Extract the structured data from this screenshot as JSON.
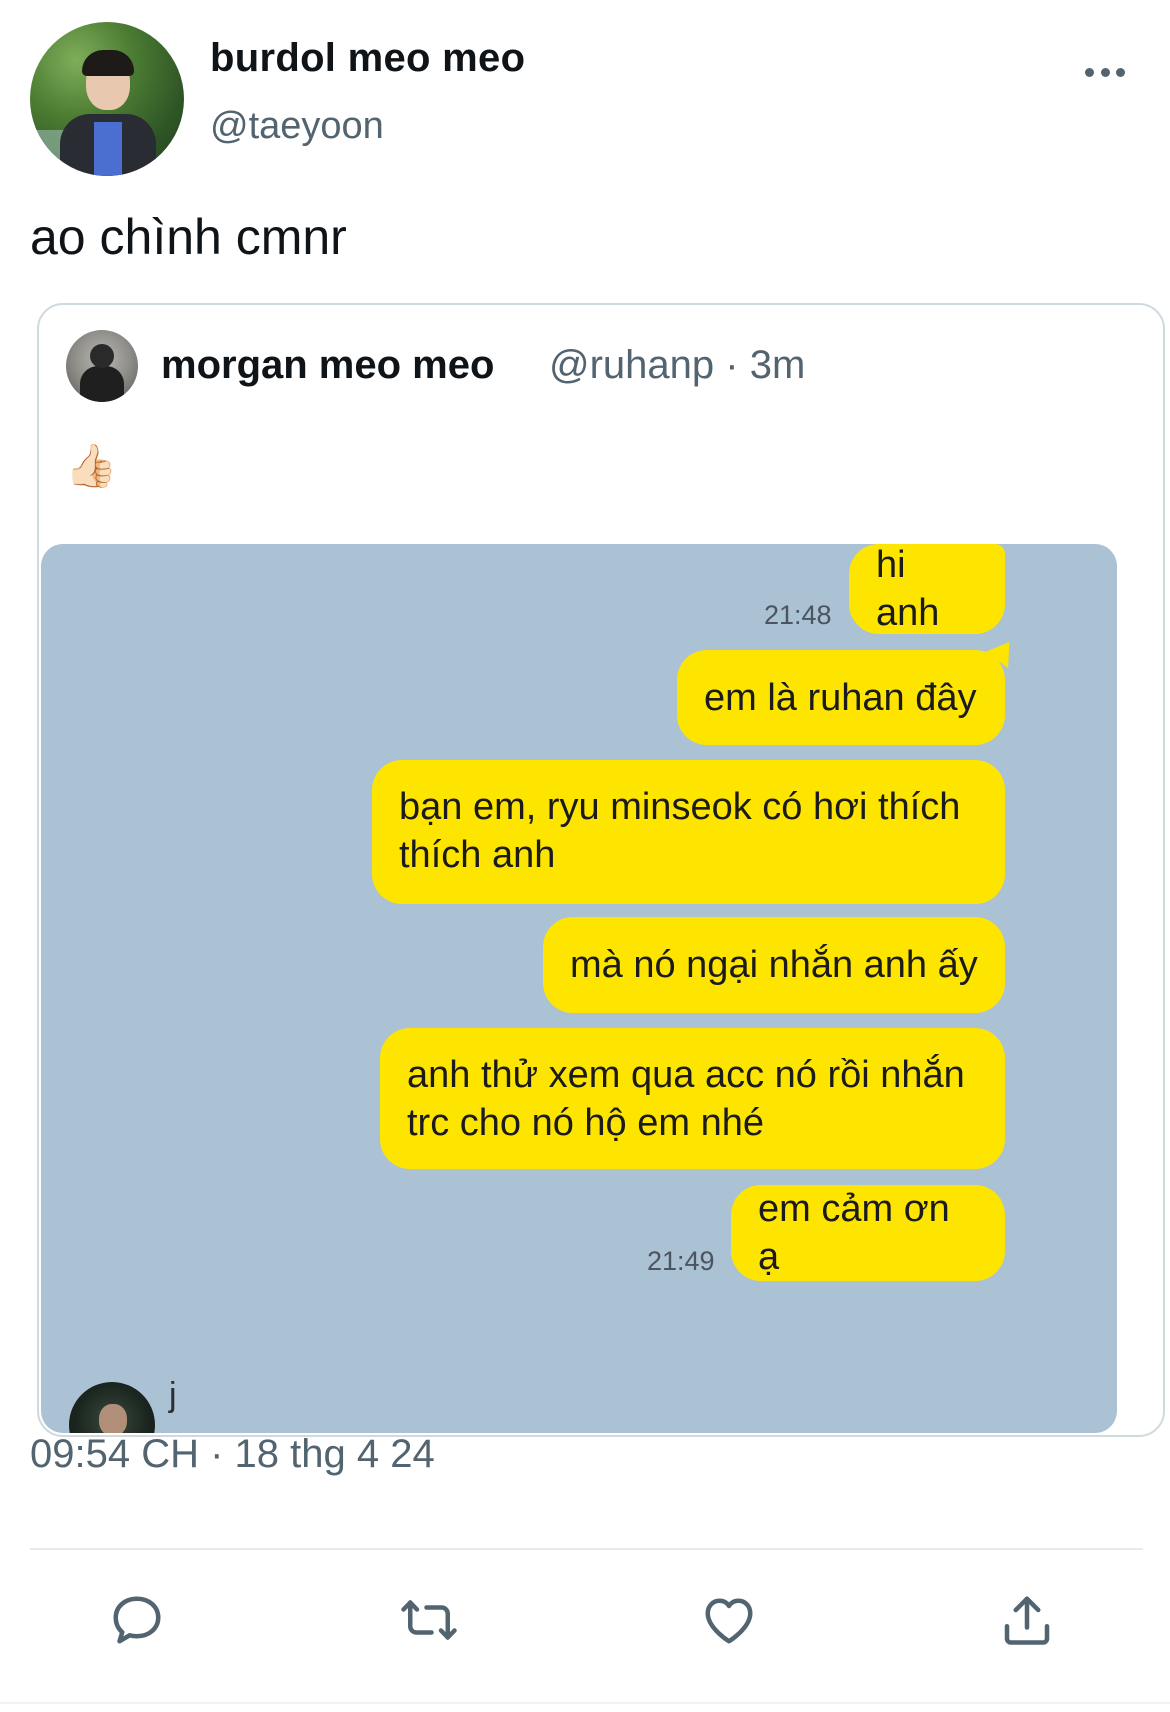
{
  "tweet": {
    "display_name": "burdol meo meo",
    "handle": "@taeyoon",
    "text": "ao chình cmnr",
    "timestamp": "09:54 CH · 18 thg 4 24"
  },
  "quote": {
    "display_name": "morgan meo meo",
    "meta": "@ruhanp · 3m",
    "text": "👍🏻"
  },
  "chat": {
    "messages": [
      {
        "text": "hi anh",
        "time": "21:48"
      },
      {
        "text": "em là ruhan đây"
      },
      {
        "text": "bạn em, ryu minseok có hơi thích thích anh"
      },
      {
        "text": "mà nó ngại nhắn anh ấy"
      },
      {
        "text": "anh thử xem qua acc nó rồi nhắn trc cho nó hộ em nhé"
      },
      {
        "text": "em cảm ơn ạ",
        "time": "21:49"
      }
    ],
    "other_sender_name": "j"
  },
  "icons": {
    "more": "more-horizontal-icon",
    "reply": "reply-icon",
    "retweet": "retweet-icon",
    "like": "heart-icon",
    "share": "share-icon"
  },
  "colors": {
    "bubble": "#fee500",
    "chat_background": "#abc1d4",
    "secondary_text": "#536471"
  }
}
